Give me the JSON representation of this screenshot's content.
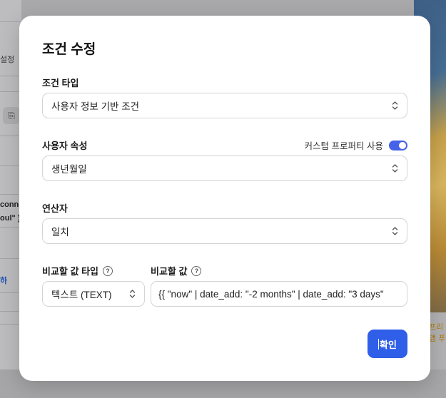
{
  "background": {
    "left_snippets": [
      "설정",
      "conne",
      "oul\" }",
      "하"
    ],
    "right_snippets": [
      "프리",
      "앱 푸"
    ]
  },
  "modal": {
    "title": "조건 수정",
    "condition_type": {
      "label": "조건 타입",
      "value": "사용자 정보 기반 조건"
    },
    "user_attribute": {
      "label": "사용자 속성",
      "custom_property_label": "커스텀 프로퍼티 사용",
      "custom_property_enabled": true,
      "value": "생년월일"
    },
    "operator": {
      "label": "연산자",
      "value": "일치"
    },
    "compare_value_type": {
      "label": "비교할 값 타입",
      "value": "텍스트 (TEXT)"
    },
    "compare_value": {
      "label": "비교할 값",
      "value": "{{ \"now\" | date_add: \"-2 months\" | date_add: \"3 days\""
    },
    "confirm_label": "확인"
  },
  "colors": {
    "accent": "#2f5ee8",
    "toggle_on": "#4662e8"
  }
}
